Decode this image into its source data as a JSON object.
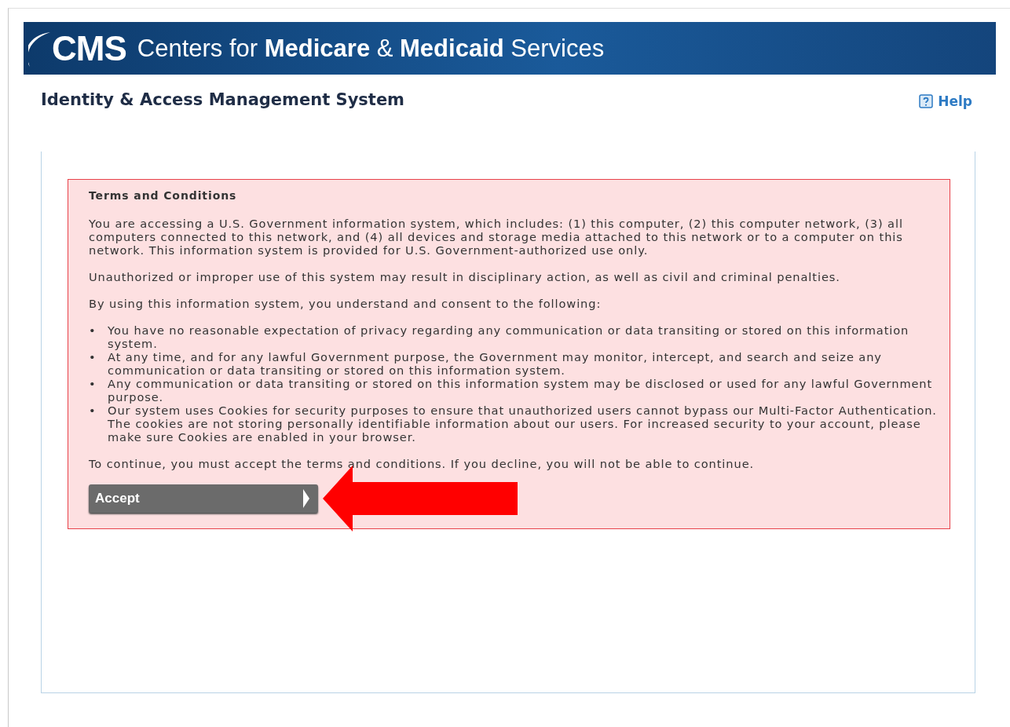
{
  "banner": {
    "logo": "CMS",
    "title": "Centers for **Medicare** & **Medicaid** Services"
  },
  "header": {
    "title": "Identity & Access Management System",
    "help": "Help"
  },
  "terms": {
    "title": "Terms and Conditions",
    "paragraphs": [
      "You are accessing a U.S. Government information system, which includes: (1) this computer, (2) this computer network, (3) all computers connected to this network, and (4) all devices and storage media attached to this network or to a computer on this network. This information system is provided for U.S. Government-authorized use only.",
      "Unauthorized or improper use of this system may result in disciplinary action, as well as civil and criminal penalties.",
      "By using this information system, you understand and consent to the following:"
    ],
    "bullets": [
      {
        "marker": "•",
        "text": "You have no reasonable expectation of privacy regarding any communication or data transiting or stored on this information system."
      },
      {
        "marker": "•",
        "text": "At any time, and for any lawful Government purpose, the Government may monitor, intercept, and search and seize any communication or data transiting or stored on this information system."
      },
      {
        "marker": "•",
        "text": "Any communication or data transiting or stored on this information system may be disclosed or used for any lawful Government purpose."
      },
      {
        "marker": "•",
        "text": "Our system uses Cookies for security purposes to ensure that unauthorized users cannot bypass our Multi-Factor Authentication. The cookies are not storing personally identifiable information about our users. For increased security to your account, please make sure Cookies are enabled in your browser."
      }
    ],
    "closing": "To continue, you must accept the terms and conditions. If you decline, you will not be able to continue.",
    "accept_button": "Accept"
  }
}
